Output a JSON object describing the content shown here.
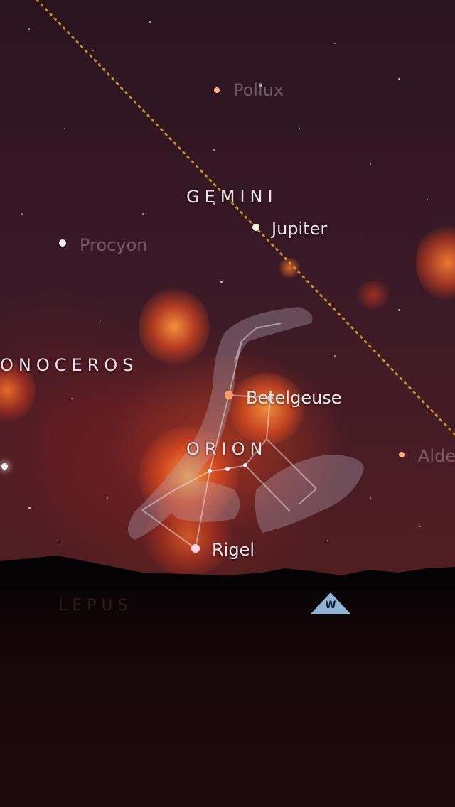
{
  "stars": [
    {
      "name": "Pollux",
      "faded": true
    },
    {
      "name": "Procyon",
      "faded": true
    },
    {
      "name": "Jupiter",
      "faded": false
    },
    {
      "name": "Betelgeuse",
      "faded": false
    },
    {
      "name": "Rigel",
      "faded": false
    },
    {
      "name": "Aldebaran",
      "faded": true,
      "display": "Alde"
    }
  ],
  "constellations": {
    "gemini": "GEMINI",
    "monoceros": "ONOCEROS",
    "orion": "ORION",
    "lepus": "LEPUS"
  },
  "compass": {
    "direction": "W"
  },
  "colors": {
    "ecliptic": "#d4a02a",
    "constellation_line": "#e8d8e0",
    "compass_marker": "#8fb4d6",
    "nebula": "#ff6a20"
  }
}
